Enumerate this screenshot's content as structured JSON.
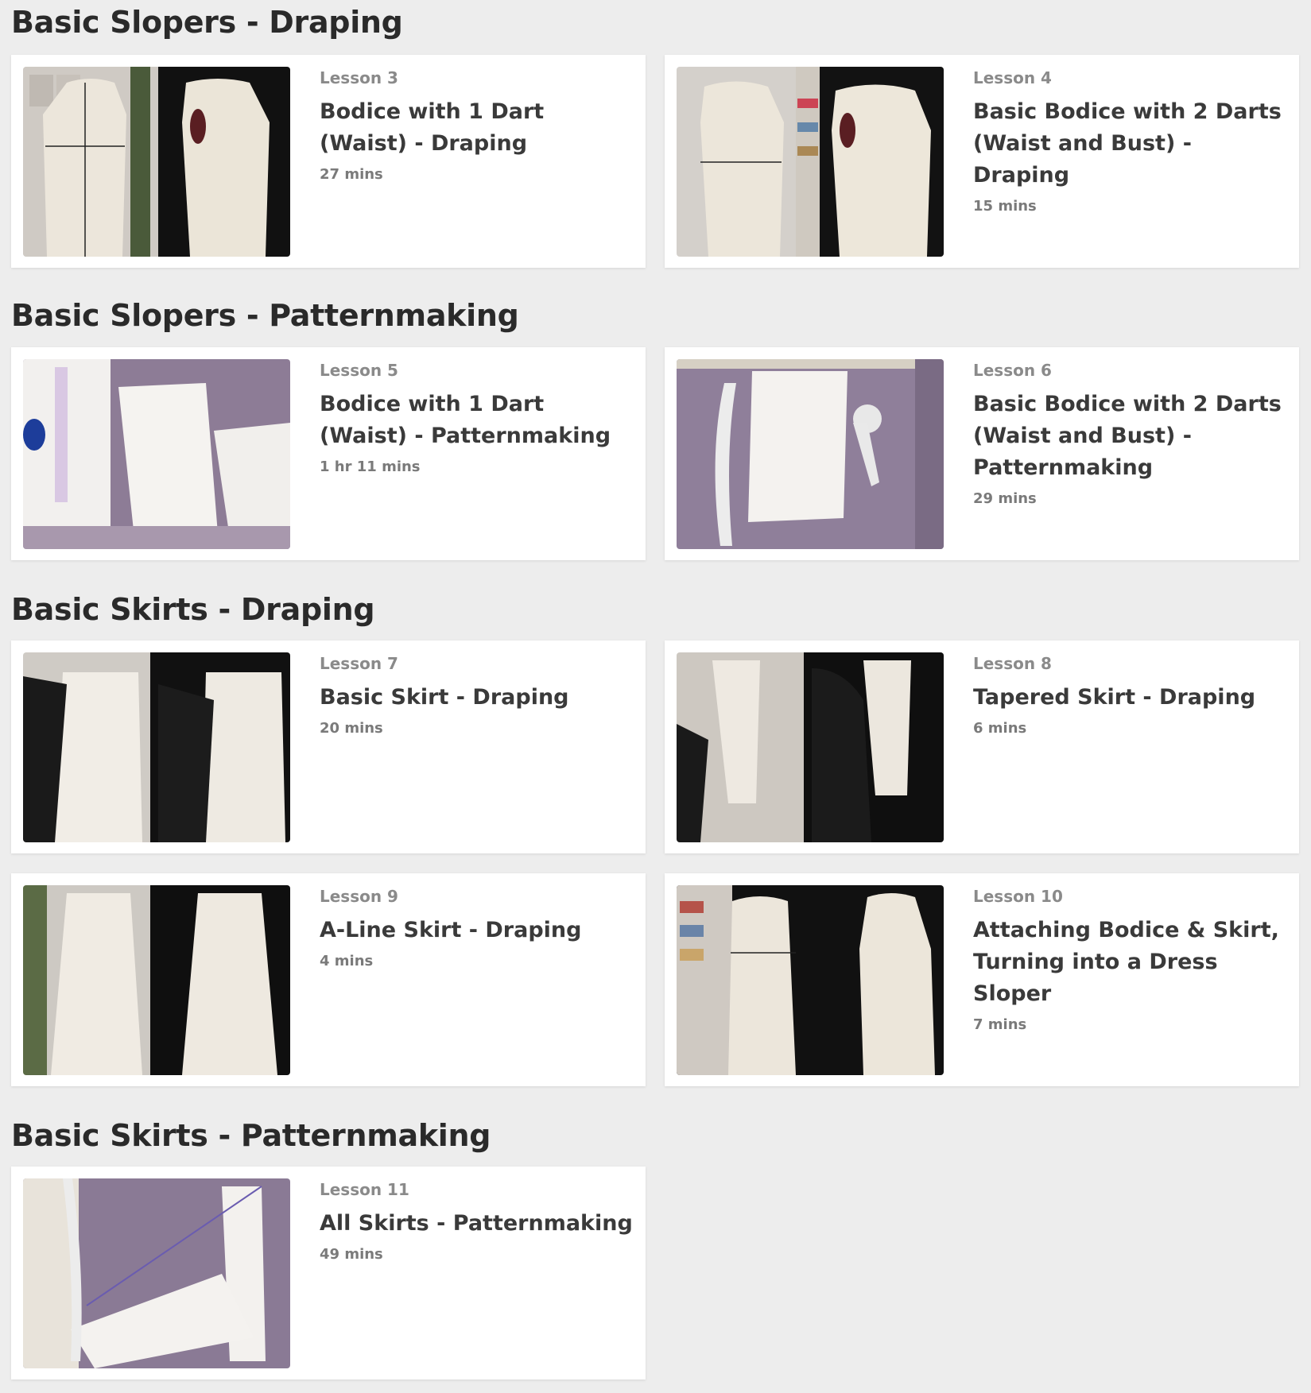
{
  "sections": [
    {
      "title": "Basic Slopers - Draping"
    },
    {
      "title": "Basic Slopers - Patternmaking"
    },
    {
      "title": "Basic Skirts - Draping"
    },
    {
      "title": "Basic Skirts - Patternmaking"
    }
  ],
  "lessons": [
    {
      "number": "Lesson 3",
      "title": "Bodice with 1 Dart (Waist) - Draping",
      "duration": "27 mins"
    },
    {
      "number": "Lesson 4",
      "title": "Basic Bodice with 2 Darts (Waist and Bust) - Draping",
      "duration": "15 mins"
    },
    {
      "number": "Lesson 5",
      "title": "Bodice with 1 Dart (Waist) - Patternmaking",
      "duration": "1 hr 11 mins"
    },
    {
      "number": "Lesson 6",
      "title": "Basic Bodice with 2 Darts (Waist and Bust) - Patternmaking",
      "duration": "29 mins"
    },
    {
      "number": "Lesson 7",
      "title": "Basic Skirt - Draping",
      "duration": "20 mins"
    },
    {
      "number": "Lesson 8",
      "title": "Tapered Skirt - Draping",
      "duration": "6 mins"
    },
    {
      "number": "Lesson 9",
      "title": "A-Line Skirt - Draping",
      "duration": "4 mins"
    },
    {
      "number": "Lesson 10",
      "title": "Attaching Bodice & Skirt, Turning into a Dress Sloper",
      "duration": "7 mins"
    },
    {
      "number": "Lesson 11",
      "title": "All Skirts - Patternmaking",
      "duration": "49 mins"
    }
  ]
}
